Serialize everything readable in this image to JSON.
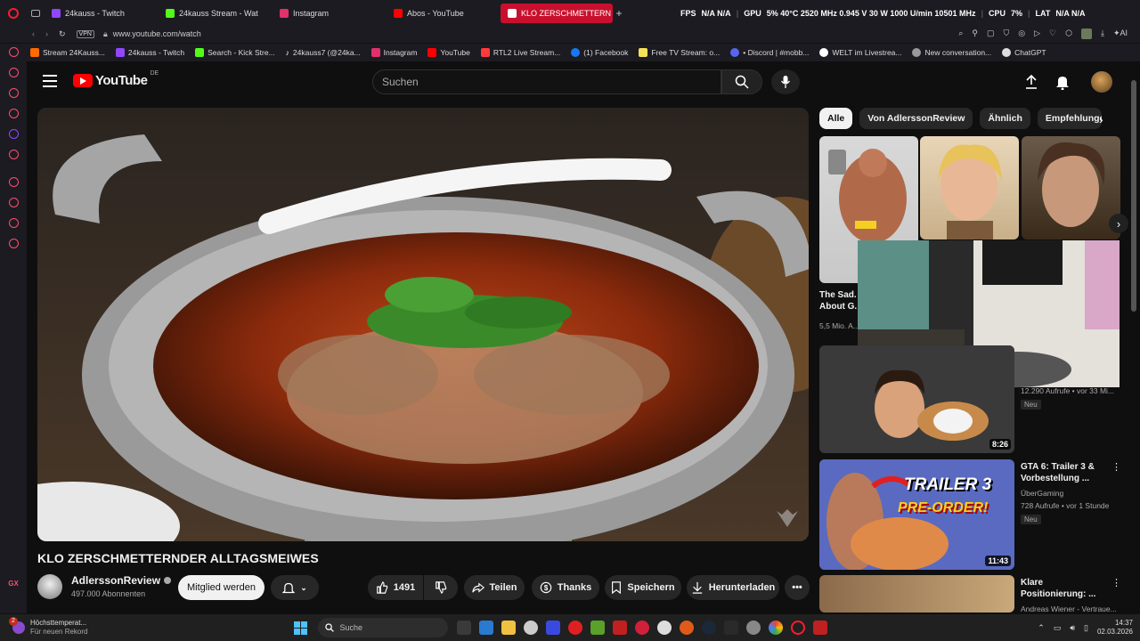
{
  "browser": {
    "tabs": [
      {
        "label": "24kauss - Twitch",
        "color": "#9146ff"
      },
      {
        "label": "24kauss Stream - Wat",
        "color": "#53fc18"
      },
      {
        "label": "Instagram",
        "color": "#e1306c"
      },
      {
        "label": "Abos - YouTube",
        "color": "#ff0000"
      },
      {
        "label": "KLO ZERSCHMETTERN",
        "color": "#ff0000",
        "active": true
      }
    ],
    "hud": {
      "fps_label": "FPS",
      "fps_value": "N/A N/A",
      "gpu_label": "GPU",
      "gpu_value": "5% 40°C 2520 MHz 0.945 V 30 W 1000 U/min 10501 MHz",
      "cpu_label": "CPU",
      "cpu_value": "7%",
      "lat_label": "LAT",
      "lat_value": "N/A N/A"
    },
    "vpn_badge": "VPN",
    "url": "www.youtube.com/watch",
    "bookmarks": [
      {
        "label": "Stream 24Kauss...",
        "color": "#ff6a00"
      },
      {
        "label": "24kauss - Twitch",
        "color": "#9146ff"
      },
      {
        "label": "Search - Kick Stre...",
        "color": "#53fc18"
      },
      {
        "label": "24kauss7 (@24ka...",
        "color": "#ffffff"
      },
      {
        "label": "Instagram",
        "color": "#e1306c"
      },
      {
        "label": "YouTube",
        "color": "#ff0000"
      },
      {
        "label": "RTL2 Live Stream...",
        "color": "#ff3b3b"
      },
      {
        "label": "(1) Facebook",
        "color": "#1877f2"
      },
      {
        "label": "Free TV Stream: o...",
        "color": "#f5e05a"
      },
      {
        "label": "• Discord | #mobb...",
        "color": "#5865f2"
      },
      {
        "label": "WELT im Livestrea...",
        "color": "#ffffff"
      },
      {
        "label": "New conversation...",
        "color": "#aaaaaa"
      },
      {
        "label": "ChatGPT",
        "color": "#dddddd"
      }
    ]
  },
  "youtube": {
    "logo_text": "YouTube",
    "region": "DE",
    "search_placeholder": "Suchen",
    "video": {
      "title": "KLO ZERSCHMETTERNDER ALLTAGSMEIWES",
      "channel": "AdlerssonReview",
      "subscribers": "497.000 Abonnenten",
      "join_label": "Mitglied werden",
      "likes": "1491",
      "share_label": "Teilen",
      "thanks_label": "Thanks",
      "save_label": "Speichern",
      "download_label": "Herunterladen"
    },
    "chips": [
      "Alle",
      "Von AdlerssonReview",
      "Ähnlich",
      "Empfehlungen"
    ],
    "sidebar_videos": [
      {
        "title": "The Sad...",
        "title2": "About G...",
        "meta": "5,5 Mio. A..."
      },
      {
        "meta": "12.290 Aufrufe • vor 33 Mi...",
        "badge": "Neu",
        "duration": "8:26"
      },
      {
        "title": "GTA 6: Trailer 3 &",
        "title2": "Vorbestellung ...",
        "channel": "ÜberGaming",
        "meta": "728 Aufrufe • vor 1 Stunde",
        "badge": "Neu",
        "duration": "11:43",
        "thumb_text1": "TRAILER 3",
        "thumb_text2": "PRE-ORDER!"
      },
      {
        "title": "Klare",
        "title2": "Positionierung: ...",
        "channel": "Andreas Wiener - Vertraue..."
      }
    ]
  },
  "taskbar": {
    "weather_title": "Höchsttemperat...",
    "weather_sub": "Für neuen Rekord",
    "notif_count": "2",
    "search_label": "Suche",
    "time": "14:37",
    "date": "02.03.2026"
  },
  "colors": {
    "accent": "#ff0000",
    "browser_bg": "#1c1b22",
    "yt_bg": "#0f0f0f"
  }
}
